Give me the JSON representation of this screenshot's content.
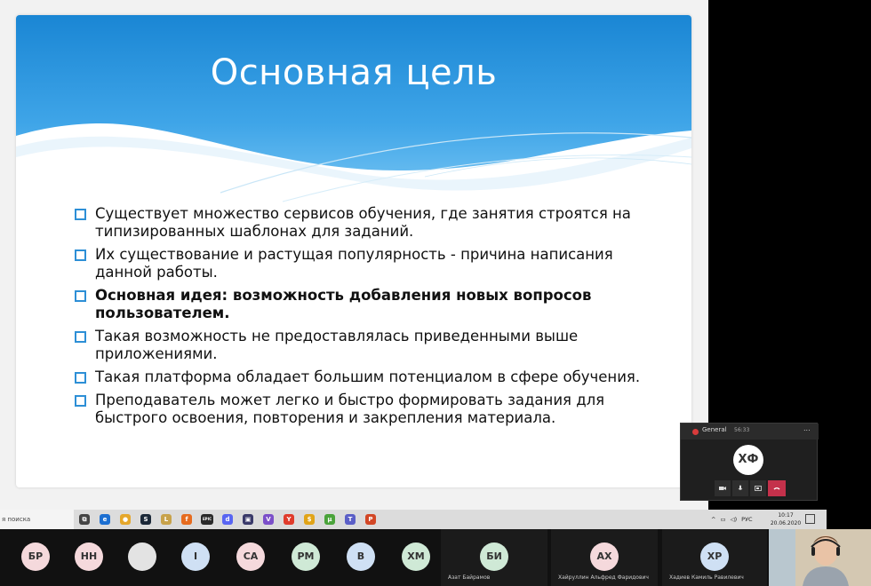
{
  "slide": {
    "title": "Основная цель",
    "bullets": [
      {
        "text": "Существует множество сервисов обучения, где занятия строятся на типизированных шаблонах для заданий.",
        "bold": false
      },
      {
        "text": "Их существование и  растущая популярность -  причина написания данной работы.",
        "bold": false
      },
      {
        "text": "Основная идея: возможность добавления новых вопросов пользователем.",
        "bold": true
      },
      {
        "text": "Такая возможность не предоставлялась приведенными выше приложениями.",
        "bold": false
      },
      {
        "text": "Такая платформа обладает большим потенциалом в сфере обучения.",
        "bold": false
      },
      {
        "text": "Преподаватель может легко и быстро формировать задания для быстрого освоения, повторения и закрепления материала.",
        "bold": false
      }
    ],
    "colors": {
      "header": "#2d8fd6",
      "bullet_box": "#2d8fd6"
    }
  },
  "call": {
    "channel": "General",
    "duration": "56:33",
    "more": "...",
    "avatar_initials": "ХФ",
    "controls": [
      "camera-icon",
      "mic-icon",
      "share-screen-icon",
      "hang-up-icon"
    ]
  },
  "taskbar": {
    "search_text": "я поиска",
    "apps": [
      {
        "name": "task-view",
        "glyph": "⧉",
        "color": "#444"
      },
      {
        "name": "edge",
        "glyph": "e",
        "color": "#1c6fd1"
      },
      {
        "name": "chrome",
        "glyph": "●",
        "color": "#e5a72b"
      },
      {
        "name": "steam",
        "glyph": "S",
        "color": "#1b2838"
      },
      {
        "name": "league",
        "glyph": "L",
        "color": "#c8a24a"
      },
      {
        "name": "firefox",
        "glyph": "f",
        "color": "#e66b1e"
      },
      {
        "name": "epic",
        "glyph": "EPIC",
        "color": "#2a2a2a"
      },
      {
        "name": "discord",
        "glyph": "d",
        "color": "#5865f2"
      },
      {
        "name": "game",
        "glyph": "▣",
        "color": "#3a3a6a"
      },
      {
        "name": "visual-studio",
        "glyph": "V",
        "color": "#7b4fc9"
      },
      {
        "name": "yandex",
        "glyph": "Y",
        "color": "#e03b2b"
      },
      {
        "name": "app-yellow",
        "glyph": "$",
        "color": "#e1a418"
      },
      {
        "name": "torrent",
        "glyph": "μ",
        "color": "#4aa33a"
      },
      {
        "name": "teams",
        "glyph": "T",
        "color": "#5b5fc7"
      },
      {
        "name": "powerpoint",
        "glyph": "P",
        "color": "#d24726"
      }
    ],
    "tray": {
      "lang": "РУС",
      "time": "10:17",
      "date": "20.06.2020"
    }
  },
  "participants": [
    {
      "initials": "БР",
      "name": "",
      "color": "pink"
    },
    {
      "initials": "НН",
      "name": "",
      "color": "pink"
    },
    {
      "initials": "",
      "name": "",
      "color": "gray"
    },
    {
      "initials": "I",
      "name": "",
      "color": "blue"
    },
    {
      "initials": "СА",
      "name": "",
      "color": "pink"
    },
    {
      "initials": "РМ",
      "name": "",
      "color": "green"
    },
    {
      "initials": "В",
      "name": "",
      "color": "blue"
    },
    {
      "initials": "ХМ",
      "name": "",
      "color": "green"
    },
    {
      "initials": "БИ",
      "name": "Азат Байрамов",
      "color": "green"
    },
    {
      "initials": "АХ",
      "name": "Хайруллин Альфред Фаридович",
      "color": "pink"
    },
    {
      "initials": "ХР",
      "name": "Хадиев Камиль Равилевич",
      "color": "blue"
    }
  ]
}
